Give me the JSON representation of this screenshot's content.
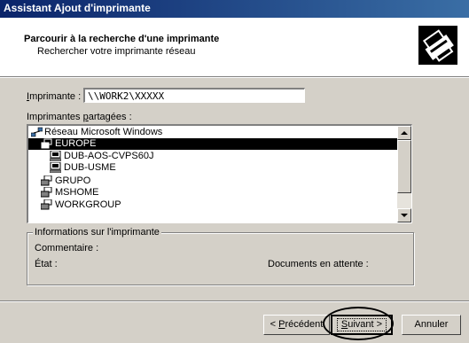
{
  "window": {
    "title": "Assistant Ajout d'imprimante"
  },
  "header": {
    "title": "Parcourir à la recherche d'une imprimante",
    "subtitle": "Rechercher votre imprimante réseau"
  },
  "printer_field": {
    "label_prefix": "I",
    "label_rest": "mprimante :",
    "value": "\\\\WORK2\\XXXXX"
  },
  "shared_label": {
    "before": "Imprimantes ",
    "underlined": "p",
    "after": "artagées :"
  },
  "tree": {
    "items": [
      {
        "label": "Réseau Microsoft Windows",
        "icon": "network-icon",
        "selected": false
      },
      {
        "label": "EUROPE",
        "icon": "workgroup-icon",
        "selected": true
      },
      {
        "label": "DUB-AOS-CVPS60J",
        "icon": "computer-icon",
        "selected": false
      },
      {
        "label": "DUB-USME",
        "icon": "computer-icon",
        "selected": false
      },
      {
        "label": "GRUPO",
        "icon": "workgroup-icon",
        "selected": false
      },
      {
        "label": "MSHOME",
        "icon": "workgroup-icon",
        "selected": false
      },
      {
        "label": "WORKGROUP",
        "icon": "workgroup-icon",
        "selected": false
      }
    ]
  },
  "info": {
    "legend": "Informations sur l'imprimante",
    "comment_label": "Commentaire :",
    "status_label": "État :",
    "queue_label": "Documents en attente :"
  },
  "buttons": {
    "back_u": "P",
    "back_before": "< ",
    "back_after": "récédent",
    "next_u": "S",
    "next_after": "uivant >",
    "cancel": "Annuler"
  }
}
